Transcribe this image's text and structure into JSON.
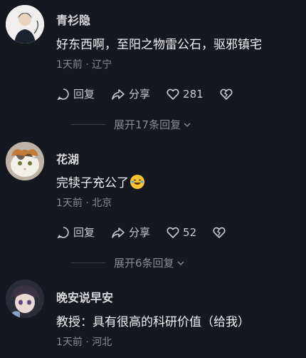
{
  "comments": [
    {
      "username": "青衫隐",
      "text": "好东西啊，至阳之物雷公石，驱邪镇宅",
      "meta": "1天前 · 辽宁",
      "reply_label": "回复",
      "share_label": "分享",
      "like_count": "281",
      "expand_label": "展开17条回复"
    },
    {
      "username": "花湖",
      "text": "完犊子充公了",
      "meta": "1天前 · 北京",
      "reply_label": "回复",
      "share_label": "分享",
      "like_count": "52",
      "expand_label": "展开6条回复"
    },
    {
      "username": "晚安说早安",
      "text": "教授：具有很高的科研价值（给我）",
      "meta": "1天前 · 河北"
    }
  ],
  "icons": [
    "reply-icon",
    "share-icon",
    "like-icon",
    "dislike-icon",
    "chevron-down-icon",
    "crying-laughing-emoji"
  ],
  "colors": {
    "background": "#16181f",
    "text": "#f1f1f3",
    "muted": "#8a8b92"
  }
}
